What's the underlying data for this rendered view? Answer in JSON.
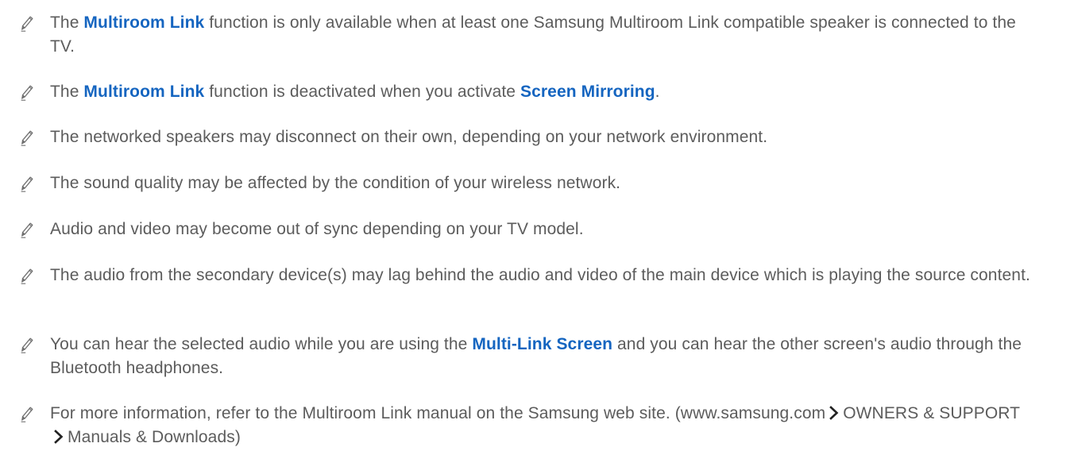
{
  "notes": [
    {
      "parts": [
        {
          "text": "The "
        },
        {
          "text": "Multiroom Link",
          "hl": true
        },
        {
          "text": " function is only available when at least one Samsung Multiroom Link compatible speaker is connected to the TV."
        }
      ]
    },
    {
      "parts": [
        {
          "text": "The "
        },
        {
          "text": "Multiroom Link",
          "hl": true
        },
        {
          "text": " function is deactivated when you activate "
        },
        {
          "text": "Screen Mirroring",
          "hl": true
        },
        {
          "text": "."
        }
      ]
    },
    {
      "parts": [
        {
          "text": "The networked speakers may disconnect on their own, depending on your network environment."
        }
      ]
    },
    {
      "parts": [
        {
          "text": "The sound quality may be affected by the condition of your wireless network."
        }
      ]
    },
    {
      "parts": [
        {
          "text": "Audio and video may become out of sync depending on your TV model."
        }
      ]
    },
    {
      "parts": [
        {
          "text": "The audio from the secondary device(s) may lag behind the audio and video of the main device which is playing the source content."
        }
      ]
    },
    {
      "parts": [
        {
          "text": "You can hear the selected audio while you are using the "
        },
        {
          "text": "Multi-Link Screen",
          "hl": true
        },
        {
          "text": " and you can hear the other screen's audio through the Bluetooth headphones."
        }
      ]
    },
    {
      "parts": [
        {
          "text": "For more information, refer to the Multiroom Link manual on the Samsung web site. (www.samsung.com"
        },
        {
          "chevron": true
        },
        {
          "text": "OWNERS & SUPPORT"
        },
        {
          "chevron": true
        },
        {
          "text": "Manuals & Downloads)"
        }
      ]
    }
  ],
  "icons": {
    "note_icon": "pencil-icon",
    "separator_icon": "chevron-right-icon"
  },
  "colors": {
    "text": "#5c5c5c",
    "highlight": "#1565c0",
    "icon": "#6f6f6f"
  }
}
